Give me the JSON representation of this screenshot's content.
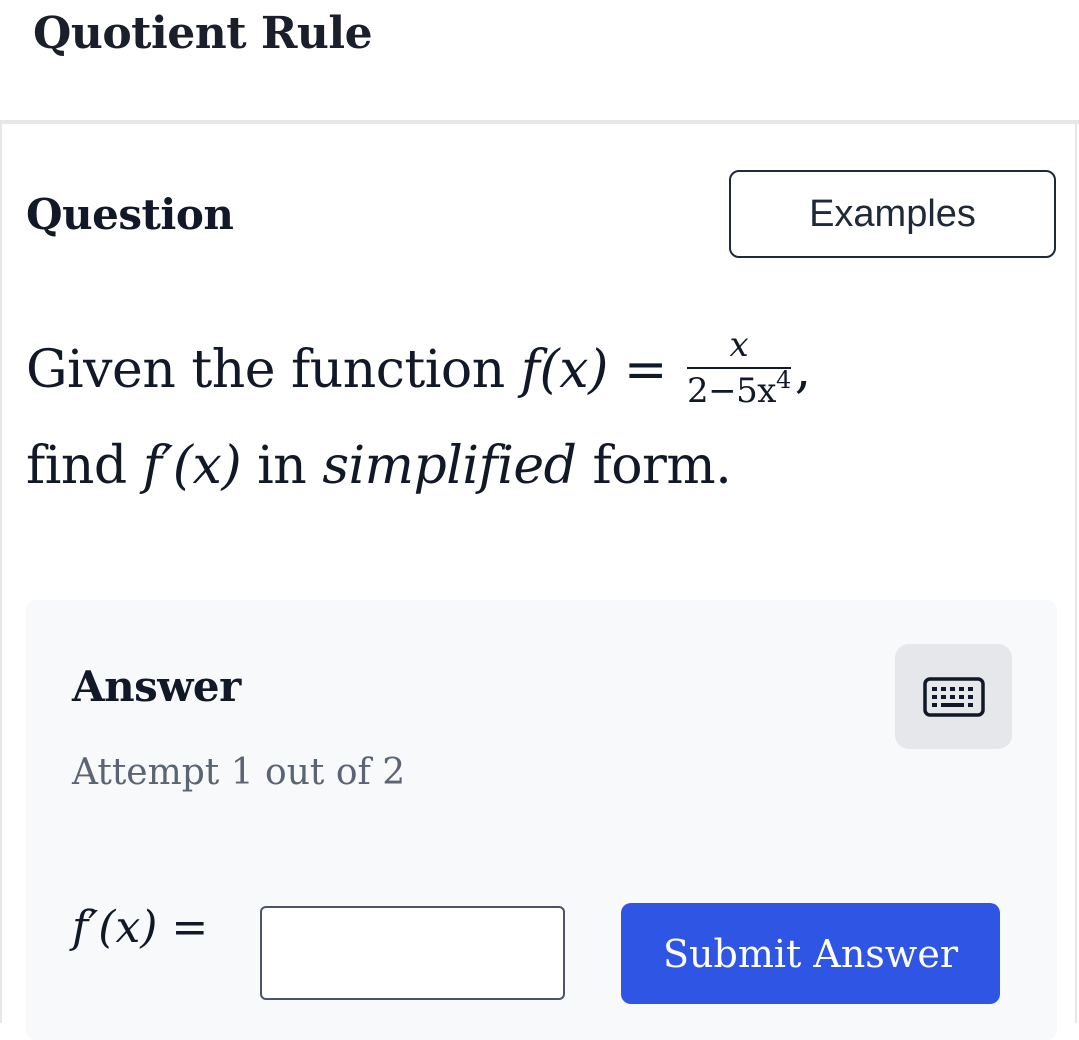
{
  "header": {
    "title": "Quotient Rule"
  },
  "question": {
    "heading": "Question",
    "examples_label": "Examples",
    "text_prefix": "Given the function ",
    "func_name": "f",
    "func_arg": "(x)",
    "equals": "=",
    "frac_numerator": "x",
    "frac_denominator_base": "2−5x",
    "frac_denominator_exp": "4",
    "comma": ",",
    "text_line2_prefix": "find ",
    "derivative": "f′(x)",
    "text_mid": " in ",
    "emphasis": "simplified",
    "text_suffix": " form."
  },
  "answer": {
    "heading": "Answer",
    "keyboard_icon": "keyboard-icon",
    "attempt_text": "Attempt 1 out of 2",
    "label_func": "f′(x)",
    "label_equals": "=",
    "input_value": "",
    "input_placeholder": "",
    "submit_label": "Submit Answer"
  },
  "colors": {
    "submit_bg": "#2f55e4",
    "panel_bg": "#f8f9fb",
    "keyboard_bg": "#e5e7eb"
  }
}
